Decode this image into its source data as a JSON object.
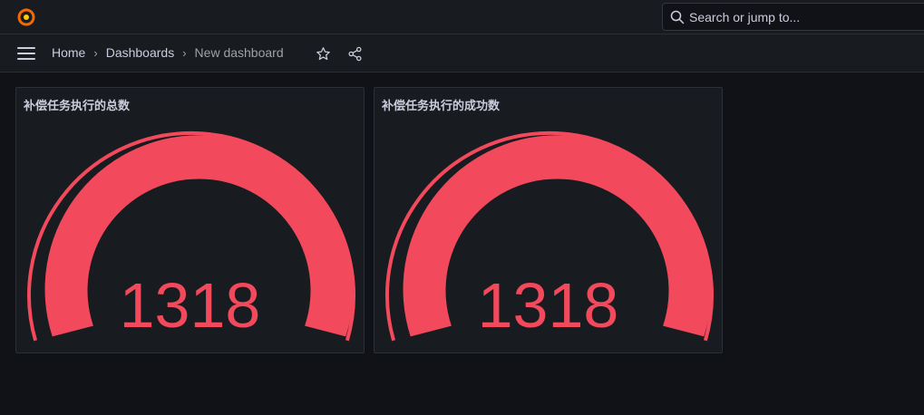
{
  "topbar": {
    "search_placeholder": "Search or jump to..."
  },
  "icons": {
    "logo": "grafana-logo-icon",
    "search": "search-icon",
    "menu": "hamburger-menu-icon",
    "star": "star-icon",
    "share": "share-icon"
  },
  "breadcrumb": {
    "home": "Home",
    "dashboards": "Dashboards",
    "current": "New dashboard",
    "separator": "›"
  },
  "colors": {
    "gauge": "#f2495c",
    "background": "#111217",
    "panel": "#181b1f"
  },
  "panels": [
    {
      "title": "补偿任务执行的总数",
      "value": "1318"
    },
    {
      "title": "补偿任务执行的成功数",
      "value": "1318"
    }
  ]
}
